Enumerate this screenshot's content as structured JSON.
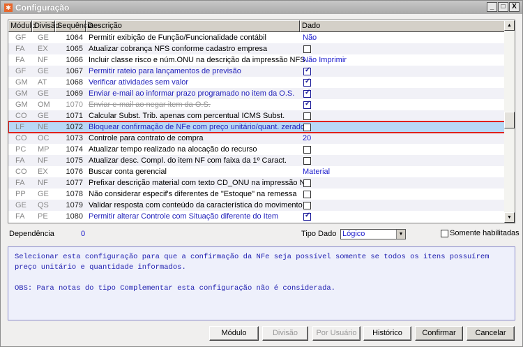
{
  "window": {
    "title": "Configuração",
    "controls": [
      "_",
      "□",
      "X"
    ]
  },
  "grid": {
    "headers": [
      "Módulo",
      "Divisão",
      "Sequência",
      "Descrição",
      "Dado"
    ],
    "rows": [
      {
        "modulo": "GF",
        "divisao": "GE",
        "seq": "1064",
        "desc": "Permitir exibição de Função/Funcionalidade contábil",
        "style": "",
        "dado_text": "Não"
      },
      {
        "modulo": "FA",
        "divisao": "EX",
        "seq": "1065",
        "desc": "Atualizar cobrança NFS conforme cadastro empresa",
        "style": "",
        "checked": false
      },
      {
        "modulo": "FA",
        "divisao": "NF",
        "seq": "1066",
        "desc": "Incluir classe risco e núm.ONU na descrição da impressão NFS",
        "style": "",
        "dado_text": "Não Imprimir"
      },
      {
        "modulo": "GF",
        "divisao": "GE",
        "seq": "1067",
        "desc": "Permitir rateio para lançamentos de previsão",
        "style": "blue",
        "checked": true
      },
      {
        "modulo": "GM",
        "divisao": "AT",
        "seq": "1068",
        "desc": "Verificar atividades sem valor",
        "style": "blue",
        "checked": true
      },
      {
        "modulo": "GM",
        "divisao": "GE",
        "seq": "1069",
        "desc": "Enviar e-mail ao informar prazo programado no item da O.S.",
        "style": "blue",
        "checked": true
      },
      {
        "modulo": "GM",
        "divisao": "OM",
        "seq": "1070",
        "desc": "Enviar e-mail ao negar item da O.S.",
        "style": "strike",
        "checked": true
      },
      {
        "modulo": "CO",
        "divisao": "GE",
        "seq": "1071",
        "desc": "Calcular Subst. Trib. apenas com percentual ICMS Subst.",
        "style": "",
        "checked": false
      },
      {
        "modulo": "LF",
        "divisao": "NE",
        "seq": "1072",
        "desc": "Bloquear confirmação de NFe com preço unitário/quant. zerado",
        "style": "blue",
        "checked": false,
        "selected": true
      },
      {
        "modulo": "CO",
        "divisao": "OC",
        "seq": "1073",
        "desc": "Controle para contrato de compra",
        "style": "",
        "dado_text": "20"
      },
      {
        "modulo": "PC",
        "divisao": "MP",
        "seq": "1074",
        "desc": "Atualizar tempo realizado na alocação do recurso",
        "style": "",
        "checked": false
      },
      {
        "modulo": "FA",
        "divisao": "NF",
        "seq": "1075",
        "desc": "Atualizar desc. Compl. do item NF com faixa da 1º Caract.",
        "style": "",
        "checked": false
      },
      {
        "modulo": "CO",
        "divisao": "EX",
        "seq": "1076",
        "desc": "Buscar conta gerencial",
        "style": "",
        "dado_text": "Material"
      },
      {
        "modulo": "FA",
        "divisao": "NF",
        "seq": "1077",
        "desc": "Prefixar descrição material com texto CD_ONU na impressão NF",
        "style": "",
        "checked": false
      },
      {
        "modulo": "PP",
        "divisao": "GE",
        "seq": "1078",
        "desc": "Não considerar especif's diferentes de \"Estoque\" na remessa",
        "style": "",
        "checked": false
      },
      {
        "modulo": "GE",
        "divisao": "QS",
        "seq": "1079",
        "desc": "Validar resposta com conteúdo da característica do movimento",
        "style": "",
        "checked": false
      },
      {
        "modulo": "FA",
        "divisao": "PE",
        "seq": "1080",
        "desc": "Permitir alterar Controle com Situação diferente do Item",
        "style": "blue",
        "checked": true
      }
    ]
  },
  "footer": {
    "dependencia_label": "Dependência",
    "dependencia_value": "0",
    "tipo_dado_label": "Tipo Dado",
    "tipo_dado_value": "Lógico",
    "somente_label": "Somente habilitadas"
  },
  "description": {
    "line1": "Selecionar esta configuração para que a confirmação da NFe seja possível somente se todos os itens possuírem preço unitário e quantidade informados.",
    "line2": "OBS: Para notas do tipo Complementar esta configuração não é considerada."
  },
  "buttons": {
    "modulo": "Módulo",
    "divisao": "Divisão",
    "por_usuario": "Por Usuário",
    "historico": "Histórico",
    "confirmar": "Confirmar",
    "cancelar": "Cancelar"
  }
}
